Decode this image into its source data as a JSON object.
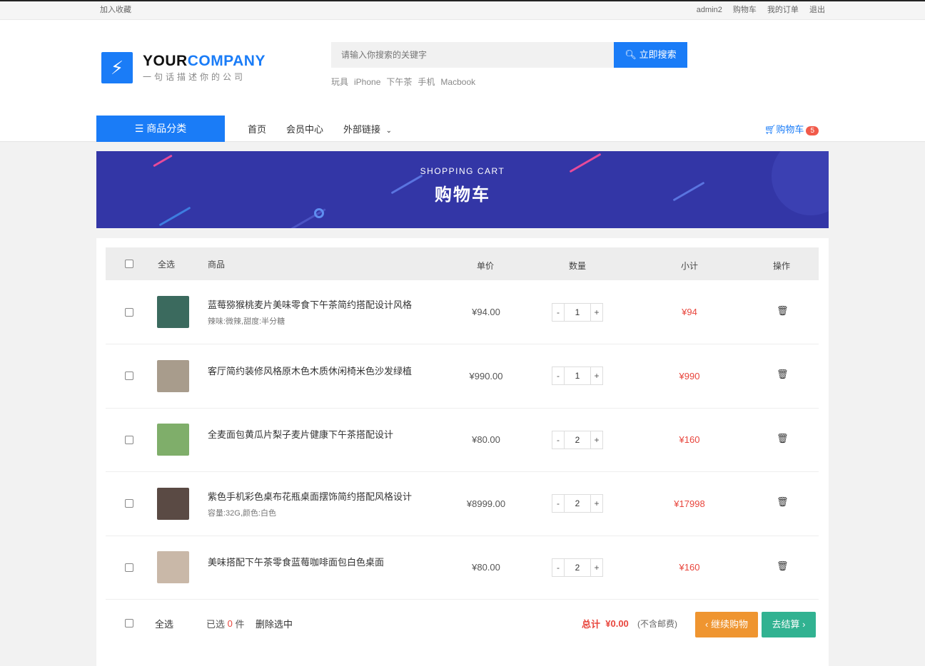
{
  "topbar": {
    "favorite": "加入收藏",
    "links": [
      "admin2",
      "购物车",
      "我的订单",
      "退出"
    ]
  },
  "logo": {
    "name_a": "YOUR",
    "name_b": "COMPANY",
    "slogan": "一句话描述你的公司"
  },
  "search": {
    "placeholder": "请输入你搜索的关键字",
    "button": "立即搜索",
    "hot": [
      "玩具",
      "iPhone",
      "下午茶",
      "手机",
      "Macbook"
    ]
  },
  "nav": {
    "category": "商品分类",
    "items": [
      "首页",
      "会员中心",
      "外部链接"
    ],
    "cart": "购物车",
    "cart_count": "5"
  },
  "banner": {
    "en": "SHOPPING CART",
    "cn": "购物车"
  },
  "table": {
    "headers": {
      "select_all": "全选",
      "product": "商品",
      "price": "单价",
      "qty": "数量",
      "subtotal": "小计",
      "action": "操作"
    },
    "rows": [
      {
        "name": "蓝莓猕猴桃麦片美味零食下午茶简约搭配设计风格",
        "spec": "辣味:微辣,甜度:半分糖",
        "price": "¥94.00",
        "qty": "1",
        "subtotal": "¥94",
        "color": "#3b6a5e"
      },
      {
        "name": "客厅简约装修风格原木色木质休闲椅米色沙发绿植",
        "spec": "",
        "price": "¥990.00",
        "qty": "1",
        "subtotal": "¥990",
        "color": "#a89c8c"
      },
      {
        "name": "全麦面包黄瓜片梨子麦片健康下午茶搭配设计",
        "spec": "",
        "price": "¥80.00",
        "qty": "2",
        "subtotal": "¥160",
        "color": "#7fae6a"
      },
      {
        "name": "紫色手机彩色桌布花瓶桌面摆饰简约搭配风格设计",
        "spec": "容量:32G,颜色:白色",
        "price": "¥8999.00",
        "qty": "2",
        "subtotal": "¥17998",
        "color": "#5a4a44"
      },
      {
        "name": "美味搭配下午茶零食蓝莓咖啡面包白色桌面",
        "spec": "",
        "price": "¥80.00",
        "qty": "2",
        "subtotal": "¥160",
        "color": "#c9b8a8"
      }
    ]
  },
  "footer": {
    "select_all": "全选",
    "selected_prefix": "已选",
    "selected_count": "0",
    "selected_suffix": "件",
    "delete": "删除选中",
    "total_label": "总计",
    "total": "¥0.00",
    "shipping_note": "(不含邮费)",
    "continue": "‹ 继续购物",
    "checkout": "去结算 ›"
  }
}
